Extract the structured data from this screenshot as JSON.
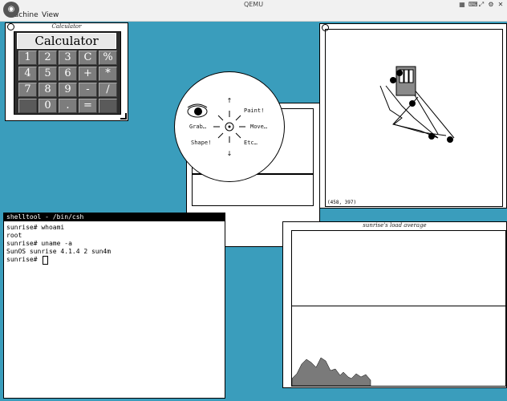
{
  "window": {
    "title": "QEMU",
    "menu": [
      "Machine",
      "View"
    ],
    "controls": [
      "grid-icon",
      "keyboard-icon",
      "fullscreen-icon",
      "settings-icon",
      "close-icon"
    ]
  },
  "calculator": {
    "title": "Calculator",
    "display": "Calculator",
    "keys": [
      [
        "1",
        "2",
        "3",
        "C",
        "%"
      ],
      [
        "4",
        "5",
        "6",
        "+",
        "*"
      ],
      [
        "7",
        "8",
        "9",
        "-",
        "/"
      ],
      [
        "",
        "0",
        ".",
        "=",
        ""
      ]
    ]
  },
  "pie_menu": {
    "items": [
      "Paint!",
      "Move…",
      "Etc…",
      "Shape!",
      "Grab…"
    ]
  },
  "canvas": {
    "coords": "(458, 397)"
  },
  "load_average": {
    "title": "sunrise's load average"
  },
  "terminal": {
    "title": "shelltool - /bin/csh",
    "lines": [
      "sunrise# whoami",
      "root",
      "sunrise# uname -a",
      "SunOS sunrise 4.1.4 2 sun4m",
      "sunrise# "
    ]
  }
}
